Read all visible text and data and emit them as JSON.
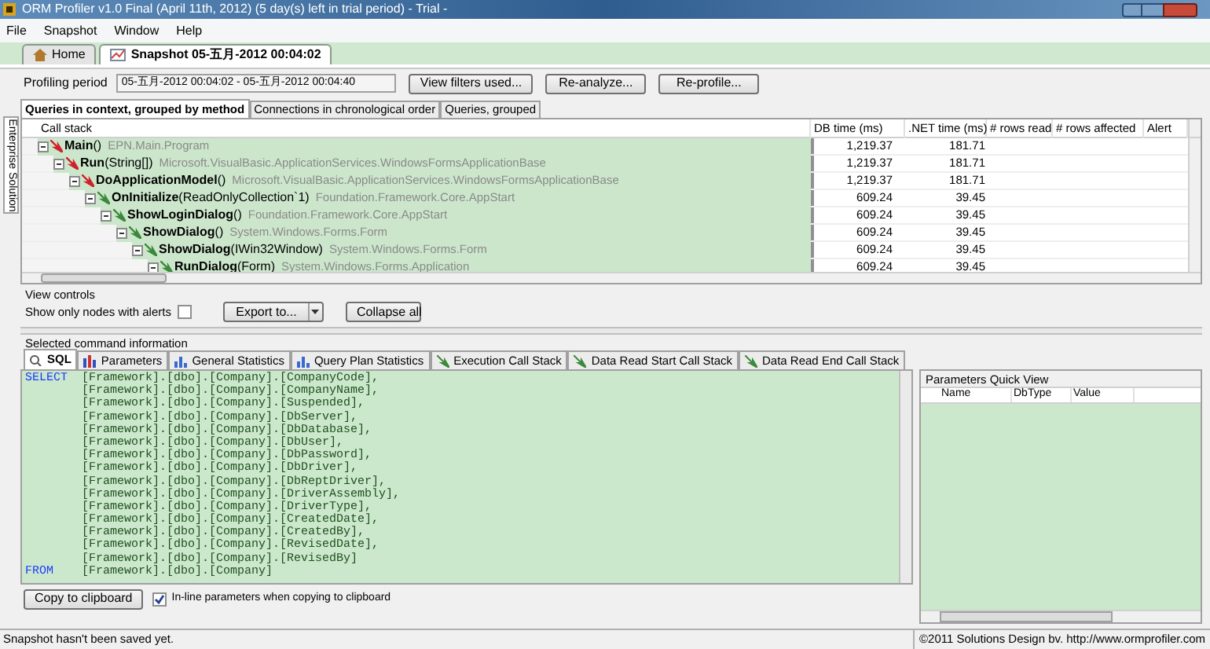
{
  "window": {
    "title": "ORM Profiler v1.0 Final (April 11th, 2012) (5 day(s) left in trial period)  - Trial -"
  },
  "menu": [
    "File",
    "Snapshot",
    "Window",
    "Help"
  ],
  "document_tabs": [
    {
      "label": "Home",
      "kind": "home",
      "selected": false
    },
    {
      "label": "Snapshot 05-五月-2012 00:04:02",
      "kind": "snapshot",
      "selected": true
    }
  ],
  "side_tab": "Enterprise Solution",
  "profiling_period": {
    "label": "Profiling period",
    "value": "05-五月-2012 00:04:02  -  05-五月-2012 00:04:40"
  },
  "toolbar_buttons": [
    "View filters used...",
    "Re-analyze...",
    "Re-profile..."
  ],
  "view_tabs": [
    {
      "label": "Queries in context, grouped by method",
      "selected": true
    },
    {
      "label": "Connections in chronological order",
      "selected": false
    },
    {
      "label": "Queries, grouped",
      "selected": false
    }
  ],
  "call_tree": {
    "columns": [
      "Call stack",
      "DB time (ms)",
      ".NET time (ms)",
      "# rows read",
      "# rows affected",
      "Alert"
    ],
    "nodes": [
      {
        "method": "**Main**()",
        "type": "EPN.Main.Program",
        "db_time": "1,219.37",
        "net_time": "181.71",
        "kind": "alert",
        "expanded": true,
        "children": [
          {
            "method": "**Run**(String[])",
            "type": "Microsoft.VisualBasic.ApplicationServices.WindowsFormsApplicationBase",
            "db_time": "1,219.37",
            "net_time": "181.71",
            "kind": "alert",
            "expanded": true,
            "children": [
              {
                "method": "**DoApplicationModel**()",
                "type": "Microsoft.VisualBasic.ApplicationServices.WindowsFormsApplicationBase",
                "db_time": "1,219.37",
                "net_time": "181.71",
                "kind": "alert",
                "expanded": true,
                "children": [
                  {
                    "method": "**OnInitialize**(ReadOnlyCollection`1)",
                    "type": "Foundation.Framework.Core.AppStart",
                    "db_time": "609.24",
                    "net_time": "39.45",
                    "kind": "normal",
                    "expanded": true,
                    "children": [
                      {
                        "method": "**ShowLoginDialog**()",
                        "type": "Foundation.Framework.Core.AppStart",
                        "db_time": "609.24",
                        "net_time": "39.45",
                        "kind": "normal",
                        "expanded": true,
                        "children": [
                          {
                            "method": "**ShowDialog**()",
                            "type": "System.Windows.Forms.Form",
                            "db_time": "609.24",
                            "net_time": "39.45",
                            "kind": "normal",
                            "expanded": true,
                            "children": [
                              {
                                "method": "**ShowDialog**(IWin32Window)",
                                "type": "System.Windows.Forms.Form",
                                "db_time": "609.24",
                                "net_time": "39.45",
                                "kind": "normal",
                                "expanded": true,
                                "children": [
                                  {
                                    "method": "**RunDialog**(Form)",
                                    "type": "System.Windows.Forms.Application",
                                    "db_time": "609.24",
                                    "net_time": "39.45",
                                    "kind": "normal",
                                    "expanded": true
                                  }
                                ]
                              }
                            ]
                          }
                        ]
                      }
                    ]
                  }
                ]
              }
            ]
          }
        ]
      }
    ]
  },
  "view_controls": {
    "title": "View controls",
    "alerts_only": {
      "label": "Show only nodes with alerts",
      "checked": false
    },
    "buttons": [
      "Export to...",
      "Collapse all"
    ]
  },
  "command_info": {
    "title": "Selected command information",
    "tabs": [
      {
        "label": "SQL",
        "kind": "sql",
        "selected": true
      },
      {
        "label": "Parameters",
        "kind": "params",
        "selected": false
      },
      {
        "label": "General Statistics",
        "kind": "stats",
        "selected": false
      },
      {
        "label": "Query Plan Statistics",
        "kind": "stats",
        "selected": false
      },
      {
        "label": "Execution Call Stack",
        "kind": "stack",
        "selected": false
      },
      {
        "label": "Data Read Start Call Stack",
        "kind": "stack",
        "selected": false
      },
      {
        "label": "Data Read End Call Stack",
        "kind": "stack",
        "selected": false
      }
    ],
    "sql_lines": [
      {
        "keyword": "SELECT",
        "text": "[Framework].[dbo].[Company].[CompanyCode],"
      },
      {
        "text": "[Framework].[dbo].[Company].[CompanyName],"
      },
      {
        "text": "[Framework].[dbo].[Company].[Suspended],"
      },
      {
        "text": "[Framework].[dbo].[Company].[DbServer],"
      },
      {
        "text": "[Framework].[dbo].[Company].[DbDatabase],"
      },
      {
        "text": "[Framework].[dbo].[Company].[DbUser],"
      },
      {
        "text": "[Framework].[dbo].[Company].[DbPassword],"
      },
      {
        "text": "[Framework].[dbo].[Company].[DbDriver],"
      },
      {
        "text": "[Framework].[dbo].[Company].[DbReptDriver],"
      },
      {
        "text": "[Framework].[dbo].[Company].[DriverAssembly],"
      },
      {
        "text": "[Framework].[dbo].[Company].[DriverType],"
      },
      {
        "text": "[Framework].[dbo].[Company].[CreatedDate],"
      },
      {
        "text": "[Framework].[dbo].[Company].[CreatedBy],"
      },
      {
        "text": "[Framework].[dbo].[Company].[RevisedDate],"
      },
      {
        "text": "[Framework].[dbo].[Company].[RevisedBy]"
      },
      {
        "keyword": "FROM",
        "text": "[Framework].[dbo].[Company]"
      }
    ],
    "copy_button": "Copy to clipboard",
    "inline_params": {
      "label": "In-line parameters when copying to clipboard",
      "checked": true
    }
  },
  "parameters_quick_view": {
    "title": "Parameters Quick View",
    "columns": [
      "Name",
      "DbType",
      "Value"
    ]
  },
  "status_bar": {
    "left": "Snapshot hasn't been saved yet.",
    "right": "©2011 Solutions Design bv. http://www.ormprofiler.com"
  }
}
